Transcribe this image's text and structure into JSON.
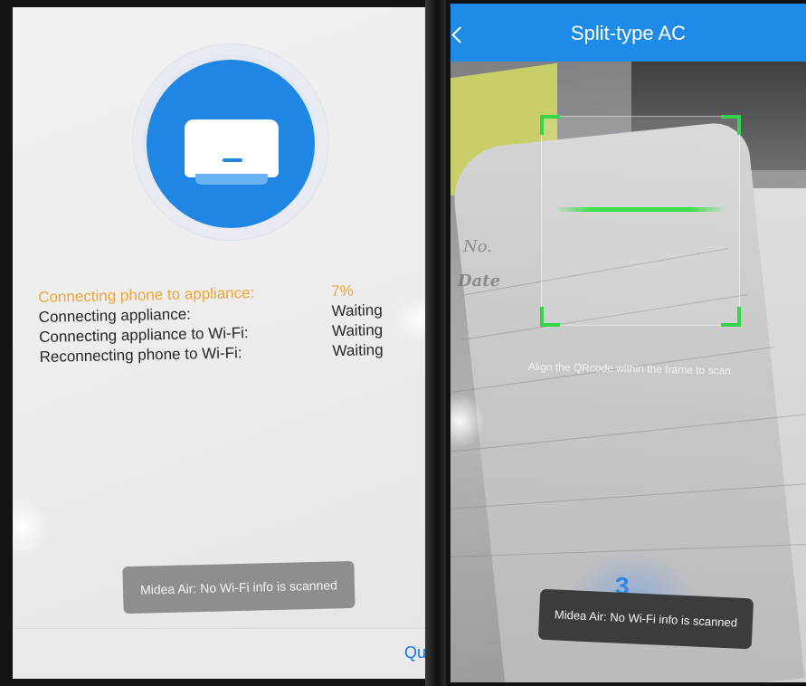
{
  "connection_screen": {
    "progress_rows": [
      {
        "label": "Connecting phone to appliance:",
        "value": "7%"
      },
      {
        "label": "Connecting appliance:",
        "value": "Waiting"
      },
      {
        "label": "Connecting appliance to Wi-Fi:",
        "value": "Waiting"
      },
      {
        "label": "Reconnecting phone to Wi-Fi:",
        "value": "Waiting"
      }
    ],
    "toast": "Midea Air: No Wi-Fi info is scanned",
    "quit_label": "Quit",
    "colors": {
      "accent": "#1f86e3",
      "active_status": "#f0a53a",
      "link": "#1677e6"
    }
  },
  "scan_screen": {
    "header": {
      "title": "Split-type AC"
    },
    "hint": "Align the QRcode within the frame to scan",
    "countdown": "3",
    "toast": "Midea Air: No Wi-Fi info is scanned",
    "colors": {
      "header": "#1e8be9",
      "scan_frame": "#35d44a"
    }
  }
}
